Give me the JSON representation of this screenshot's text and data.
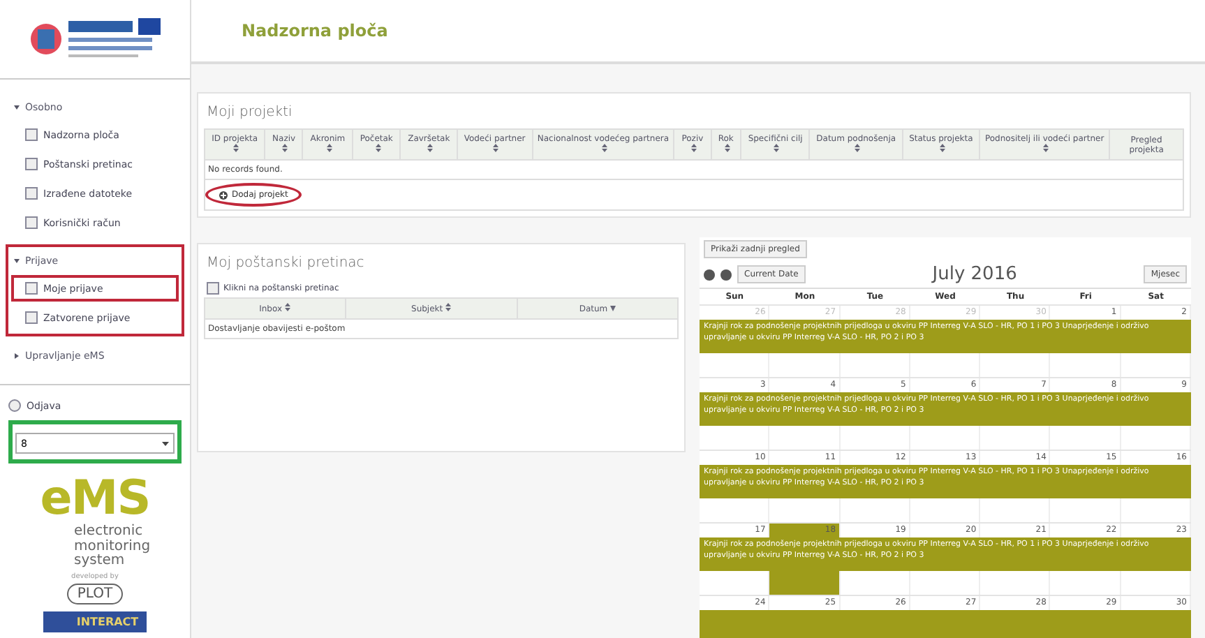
{
  "header": {
    "title": "Nadzorna ploča"
  },
  "sidebar": {
    "groups": [
      {
        "label": "Osobno",
        "expanded": true,
        "highlighted": false,
        "items": [
          {
            "label": "Nadzorna ploča",
            "highlighted": false
          },
          {
            "label": "Poštanski pretinac",
            "highlighted": false
          },
          {
            "label": "Izrađene datoteke",
            "highlighted": false
          },
          {
            "label": "Korisnički račun",
            "highlighted": false
          }
        ]
      },
      {
        "label": "Prijave",
        "expanded": true,
        "highlighted": true,
        "items": [
          {
            "label": "Moje prijave",
            "highlighted": true
          },
          {
            "label": "Zatvorene prijave",
            "highlighted": false
          }
        ]
      },
      {
        "label": "Upravljanje eMS",
        "expanded": false,
        "highlighted": false
      }
    ],
    "logout": "Odjava",
    "select": {
      "value": "8",
      "highlighted": true
    },
    "logo": {
      "name": "eMS",
      "subtitle": "electronic monitoring system",
      "developed_by": "developed by",
      "plot": "PLOT",
      "interact": "INTERACT"
    }
  },
  "projects": {
    "title": "Moji projekti",
    "columns": [
      {
        "label": "ID projekta",
        "sortable": true
      },
      {
        "label": "Naziv",
        "sortable": true
      },
      {
        "label": "Akronim",
        "sortable": true
      },
      {
        "label": "Početak",
        "sortable": true
      },
      {
        "label": "Završetak",
        "sortable": true
      },
      {
        "label": "Vodeći partner",
        "sortable": true
      },
      {
        "label": "Nacionalnost vodećeg partnera",
        "sortable": true
      },
      {
        "label": "Poziv",
        "sortable": true
      },
      {
        "label": "Rok",
        "sortable": true
      },
      {
        "label": "Specifični cilj",
        "sortable": true
      },
      {
        "label": "Datum podnošenja",
        "sortable": true
      },
      {
        "label": "Status projekta",
        "sortable": true
      },
      {
        "label": "Podnositelj ili vodeći partner",
        "sortable": true
      },
      {
        "label": "Pregled projekta",
        "sortable": false
      }
    ],
    "empty": "No records found.",
    "add": "Dodaj projekt",
    "add_highlighted": true
  },
  "mailbox": {
    "title": "Moj poštanski pretinac",
    "link": "Klikni na poštanski pretinac",
    "columns": [
      {
        "label": "Inbox",
        "descending": false
      },
      {
        "label": "Subjekt",
        "descending": false
      },
      {
        "label": "Datum",
        "descending": true
      }
    ],
    "row": "Dostavljanje obavijesti e-poštom"
  },
  "calendar": {
    "toggle": "Prikaži zadnji pregled",
    "today_button": "Current Date",
    "title": "July 2016",
    "view_button": "Mjesec",
    "days": [
      "Sun",
      "Mon",
      "Tue",
      "Wed",
      "Thu",
      "Fri",
      "Sat"
    ],
    "weeks": [
      {
        "dates": [
          {
            "label": "26",
            "other": true,
            "today": false
          },
          {
            "label": "27",
            "other": true,
            "today": false
          },
          {
            "label": "28",
            "other": true,
            "today": false
          },
          {
            "label": "29",
            "other": true,
            "today": false
          },
          {
            "label": "30",
            "other": true,
            "today": false
          },
          {
            "label": "1",
            "other": false,
            "today": false
          },
          {
            "label": "2",
            "other": false,
            "today": false
          }
        ],
        "event": "Krajnji rok za podnošenje projektnih prijedloga u okviru PP Interreg V-A SLO - HR, PO 1 i PO 3 Unaprjeđenje i održivo upravljanje u okviru PP Interreg V-A SLO - HR, PO 2 i PO 3",
        "bar": true
      },
      {
        "dates": [
          {
            "label": "3",
            "other": false,
            "today": false
          },
          {
            "label": "4",
            "other": false,
            "today": false
          },
          {
            "label": "5",
            "other": false,
            "today": false
          },
          {
            "label": "6",
            "other": false,
            "today": false
          },
          {
            "label": "7",
            "other": false,
            "today": false
          },
          {
            "label": "8",
            "other": false,
            "today": false
          },
          {
            "label": "9",
            "other": false,
            "today": false
          }
        ],
        "event": "Krajnji rok za podnošenje projektnih prijedloga u okviru PP Interreg V-A SLO - HR, PO 1 i PO 3 Unaprjeđenje i održivo upravljanje u okviru PP Interreg V-A SLO - HR, PO 2 i PO 3",
        "bar": true
      },
      {
        "dates": [
          {
            "label": "10",
            "other": false,
            "today": false
          },
          {
            "label": "11",
            "other": false,
            "today": false
          },
          {
            "label": "12",
            "other": false,
            "today": false
          },
          {
            "label": "13",
            "other": false,
            "today": false
          },
          {
            "label": "14",
            "other": false,
            "today": false
          },
          {
            "label": "15",
            "other": false,
            "today": false
          },
          {
            "label": "16",
            "other": false,
            "today": false
          }
        ],
        "event": "Krajnji rok za podnošenje projektnih prijedloga u okviru PP Interreg V-A SLO - HR, PO 1 i PO 3 Unaprjeđenje i održivo upravljanje u okviru PP Interreg V-A SLO - HR, PO 2 i PO 3",
        "bar": true
      },
      {
        "dates": [
          {
            "label": "17",
            "other": false,
            "today": false
          },
          {
            "label": "18",
            "other": false,
            "today": true
          },
          {
            "label": "19",
            "other": false,
            "today": false
          },
          {
            "label": "20",
            "other": false,
            "today": false
          },
          {
            "label": "21",
            "other": false,
            "today": false
          },
          {
            "label": "22",
            "other": false,
            "today": false
          },
          {
            "label": "23",
            "other": false,
            "today": false
          }
        ],
        "event": "Krajnji rok za podnošenje projektnih prijedloga u okviru PP Interreg V-A SLO - HR, PO 1 i PO 3 Unaprjeđenje i održivo upravljanje u okviru PP Interreg V-A SLO - HR, PO 2 i PO 3",
        "bar": true
      },
      {
        "dates": [
          {
            "label": "24",
            "other": false,
            "today": false
          },
          {
            "label": "25",
            "other": false,
            "today": false
          },
          {
            "label": "26",
            "other": false,
            "today": false
          },
          {
            "label": "27",
            "other": false,
            "today": false
          },
          {
            "label": "28",
            "other": false,
            "today": false
          },
          {
            "label": "29",
            "other": false,
            "today": false
          },
          {
            "label": "30",
            "other": false,
            "today": false
          }
        ],
        "bar": true
      }
    ]
  }
}
